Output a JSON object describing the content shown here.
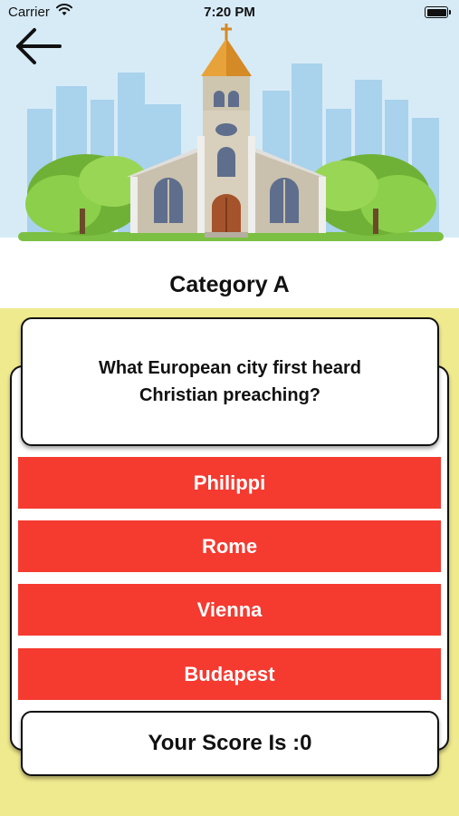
{
  "status_bar": {
    "carrier": "Carrier",
    "time": "7:20 PM",
    "battery_level": 1.0
  },
  "header": {
    "back_icon": "arrow-left-icon",
    "illustration": "church-illustration",
    "category_title": "Category A"
  },
  "quiz": {
    "question": "What European city first heard Christian preaching?",
    "answers": [
      "Philippi",
      "Rome",
      "Vienna",
      "Budapest"
    ],
    "score_text": "Your Score Is :0"
  },
  "colors": {
    "game_background": "#f0ea8e",
    "answer_button": "#f53a30",
    "sky": "#d7ebf7",
    "card_border": "#111111"
  }
}
